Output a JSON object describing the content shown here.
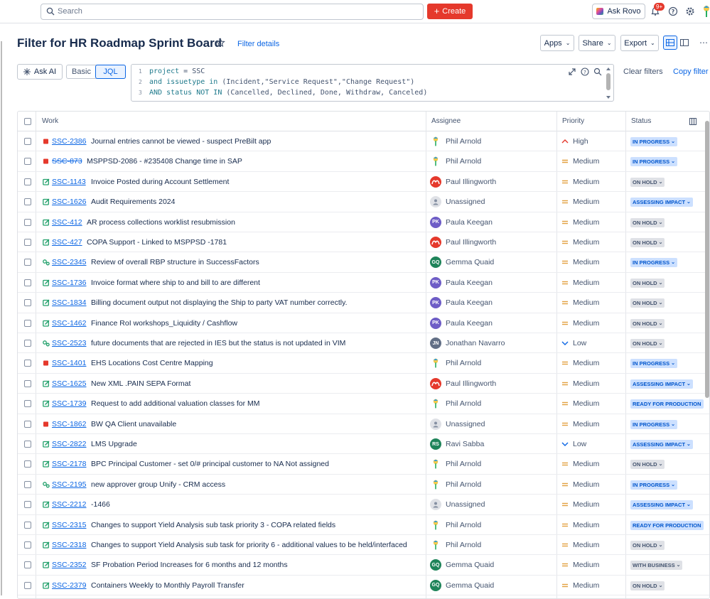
{
  "topbar": {
    "search_placeholder": "Search",
    "create_label": "Create",
    "ask_rovo_label": "Ask Rovo",
    "notifications_badge": "9+"
  },
  "header": {
    "title": "Filter for HR Roadmap Sprint Board",
    "filter_details": "Filter details",
    "apps": "Apps",
    "share": "Share",
    "export": "Export"
  },
  "query": {
    "ask_ai": "Ask AI",
    "mode_basic": "Basic",
    "mode_jql": "JQL",
    "clear_filters": "Clear filters",
    "copy_filter": "Copy filter",
    "lines": [
      {
        "num": "1",
        "k1": "project",
        "t1": " = SSC"
      },
      {
        "num": "2",
        "k1": "and issuetype in",
        "t1": " (Incident,\"Service Request\",\"Change Request\")"
      },
      {
        "num": "3",
        "k1": "AND status NOT IN",
        "t1": " (Cancelled, Declined, Done, Withdraw, Canceled)"
      }
    ]
  },
  "table": {
    "columns": [
      "Work",
      "Assignee",
      "Priority",
      "Status"
    ],
    "rows": [
      {
        "type": "incident",
        "key": "SSC-2386",
        "done": false,
        "summary": "Journal entries cannot be viewed - suspect PreBilt app",
        "assignee": "Phil Arnold",
        "av": "phil",
        "priority": "High",
        "status": "IN PROGRESS",
        "st": "blue"
      },
      {
        "type": "incident",
        "key": "SSC-873",
        "done": true,
        "summary": "MSPPSD-2086 - #235408 Change time in SAP",
        "assignee": "Phil Arnold",
        "av": "phil",
        "priority": "Medium",
        "status": "IN PROGRESS",
        "st": "blue"
      },
      {
        "type": "change",
        "key": "SSC-1143",
        "done": false,
        "summary": "Invoice Posted during Account Settlement",
        "assignee": "Paul Illingworth",
        "av": "paul",
        "priority": "Medium",
        "status": "ON HOLD",
        "st": "gray"
      },
      {
        "type": "change",
        "key": "SSC-1626",
        "done": false,
        "summary": "Audit Requirements 2024",
        "assignee": "Unassigned",
        "av": "none",
        "priority": "Medium",
        "status": "ASSESSING IMPACT",
        "st": "blue"
      },
      {
        "type": "change",
        "key": "SSC-412",
        "done": false,
        "summary": "AR process collections worklist resubmission",
        "assignee": "Paula Keegan",
        "av": "PK",
        "priority": "Medium",
        "status": "ON HOLD",
        "st": "gray"
      },
      {
        "type": "change",
        "key": "SSC-427",
        "done": false,
        "summary": "COPA Support - Linked to MSPPSD -1781",
        "assignee": "Paul Illingworth",
        "av": "paul",
        "priority": "Medium",
        "status": "ON HOLD",
        "st": "gray"
      },
      {
        "type": "service",
        "key": "SSC-2345",
        "done": false,
        "summary": "Review of overall RBP structure in SuccessFactors",
        "assignee": "Gemma Quaid",
        "av": "GQ",
        "priority": "Medium",
        "status": "IN PROGRESS",
        "st": "blue"
      },
      {
        "type": "change",
        "key": "SSC-1736",
        "done": false,
        "summary": "Invoice format where ship to and bill to are different",
        "assignee": "Paula Keegan",
        "av": "PK",
        "priority": "Medium",
        "status": "ON HOLD",
        "st": "gray"
      },
      {
        "type": "change",
        "key": "SSC-1834",
        "done": false,
        "summary": "Billing document output not displaying the Ship to party VAT number correctly.",
        "assignee": "Paula Keegan",
        "av": "PK",
        "priority": "Medium",
        "status": "ON HOLD",
        "st": "gray"
      },
      {
        "type": "change",
        "key": "SSC-1462",
        "done": false,
        "summary": "Finance RoI workshops_Liquidity / Cashflow",
        "assignee": "Paula Keegan",
        "av": "PK",
        "priority": "Medium",
        "status": "ON HOLD",
        "st": "gray"
      },
      {
        "type": "service",
        "key": "SSC-2523",
        "done": false,
        "summary": "future documents that are rejected in IES but the status is not updated in VIM",
        "assignee": "Jonathan Navarro",
        "av": "JN",
        "priority": "Low",
        "status": "ON HOLD",
        "st": "gray"
      },
      {
        "type": "incident",
        "key": "SSC-1401",
        "done": false,
        "summary": "EHS Locations Cost Centre Mapping",
        "assignee": "Phil Arnold",
        "av": "phil",
        "priority": "Medium",
        "status": "IN PROGRESS",
        "st": "blue"
      },
      {
        "type": "change",
        "key": "SSC-1625",
        "done": false,
        "summary": "New XML .PAIN SEPA Format",
        "assignee": "Paul Illingworth",
        "av": "paul",
        "priority": "Medium",
        "status": "ASSESSING IMPACT",
        "st": "blue"
      },
      {
        "type": "change",
        "key": "SSC-1739",
        "done": false,
        "summary": "Request to add additional valuation classes for MM",
        "assignee": "Phil Arnold",
        "av": "phil",
        "priority": "Medium",
        "status": "READY FOR PRODUCTION",
        "st": "blue"
      },
      {
        "type": "incident",
        "key": "SSC-1862",
        "done": false,
        "summary": "BW QA Client unavailable",
        "assignee": "Unassigned",
        "av": "none",
        "priority": "Medium",
        "status": "IN PROGRESS",
        "st": "blue"
      },
      {
        "type": "change",
        "key": "SSC-2822",
        "done": false,
        "summary": "LMS Upgrade",
        "assignee": "Ravi Sabba",
        "av": "RS",
        "priority": "Low",
        "status": "ASSESSING IMPACT",
        "st": "blue"
      },
      {
        "type": "change",
        "key": "SSC-2178",
        "done": false,
        "summary": "BPC Principal Customer - set 0/# principal customer to NA Not assigned",
        "assignee": "Phil Arnold",
        "av": "phil",
        "priority": "Medium",
        "status": "ON HOLD",
        "st": "gray"
      },
      {
        "type": "service",
        "key": "SSC-2195",
        "done": false,
        "summary": "new approver group Unify - CRM access",
        "assignee": "Phil Arnold",
        "av": "phil",
        "priority": "Medium",
        "status": "IN PROGRESS",
        "st": "blue"
      },
      {
        "type": "change",
        "key": "SSC-2212",
        "done": false,
        "summary": "-1466",
        "assignee": "Unassigned",
        "av": "none",
        "priority": "Medium",
        "status": "ASSESSING IMPACT",
        "st": "blue"
      },
      {
        "type": "change",
        "key": "SSC-2315",
        "done": false,
        "summary": "Changes to support Yield Analysis sub task priority 3 - COPA related fields",
        "assignee": "Phil Arnold",
        "av": "phil",
        "priority": "Medium",
        "status": "READY FOR PRODUCTION",
        "st": "blue"
      },
      {
        "type": "change",
        "key": "SSC-2318",
        "done": false,
        "summary": "Changes to support Yield Analysis sub task for priority 6 - additional values to be held/interfaced",
        "assignee": "Phil Arnold",
        "av": "phil",
        "priority": "Medium",
        "status": "ON HOLD",
        "st": "gray"
      },
      {
        "type": "change",
        "key": "SSC-2352",
        "done": false,
        "summary": "SF Probation Period Increases for 6 months and 12 months",
        "assignee": "Gemma Quaid",
        "av": "GQ",
        "priority": "Medium",
        "status": "WITH BUSINESS",
        "st": "gray"
      },
      {
        "type": "change",
        "key": "SSC-2379",
        "done": false,
        "summary": "Containers Weekly to Monthly Payroll Transfer",
        "assignee": "Gemma Quaid",
        "av": "GQ",
        "priority": "Medium",
        "status": "ON HOLD",
        "st": "gray"
      }
    ]
  },
  "colors": {
    "accent": "#0c66e4",
    "create": "#e5392c",
    "incident": "#e5392c",
    "change": "#22a06b",
    "PK": "#6e5dc6",
    "GQ": "#1f845a",
    "JN": "#626f86",
    "RS": "#1f845a",
    "paul": "#e5392c"
  }
}
